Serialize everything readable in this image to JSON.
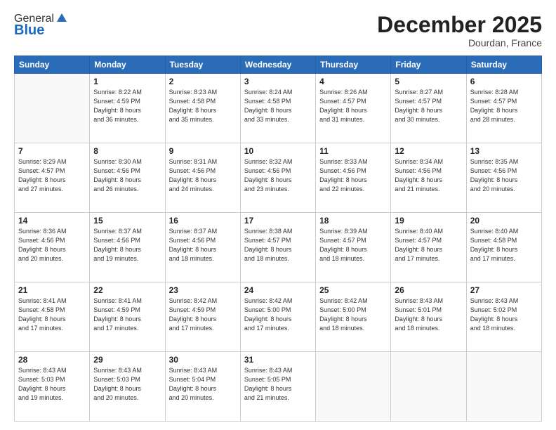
{
  "logo": {
    "general": "General",
    "blue": "Blue"
  },
  "header": {
    "month": "December 2025",
    "location": "Dourdan, France"
  },
  "days_of_week": [
    "Sunday",
    "Monday",
    "Tuesday",
    "Wednesday",
    "Thursday",
    "Friday",
    "Saturday"
  ],
  "weeks": [
    [
      {
        "day": "",
        "info": ""
      },
      {
        "day": "1",
        "info": "Sunrise: 8:22 AM\nSunset: 4:59 PM\nDaylight: 8 hours\nand 36 minutes."
      },
      {
        "day": "2",
        "info": "Sunrise: 8:23 AM\nSunset: 4:58 PM\nDaylight: 8 hours\nand 35 minutes."
      },
      {
        "day": "3",
        "info": "Sunrise: 8:24 AM\nSunset: 4:58 PM\nDaylight: 8 hours\nand 33 minutes."
      },
      {
        "day": "4",
        "info": "Sunrise: 8:26 AM\nSunset: 4:57 PM\nDaylight: 8 hours\nand 31 minutes."
      },
      {
        "day": "5",
        "info": "Sunrise: 8:27 AM\nSunset: 4:57 PM\nDaylight: 8 hours\nand 30 minutes."
      },
      {
        "day": "6",
        "info": "Sunrise: 8:28 AM\nSunset: 4:57 PM\nDaylight: 8 hours\nand 28 minutes."
      }
    ],
    [
      {
        "day": "7",
        "info": "Sunrise: 8:29 AM\nSunset: 4:57 PM\nDaylight: 8 hours\nand 27 minutes."
      },
      {
        "day": "8",
        "info": "Sunrise: 8:30 AM\nSunset: 4:56 PM\nDaylight: 8 hours\nand 26 minutes."
      },
      {
        "day": "9",
        "info": "Sunrise: 8:31 AM\nSunset: 4:56 PM\nDaylight: 8 hours\nand 24 minutes."
      },
      {
        "day": "10",
        "info": "Sunrise: 8:32 AM\nSunset: 4:56 PM\nDaylight: 8 hours\nand 23 minutes."
      },
      {
        "day": "11",
        "info": "Sunrise: 8:33 AM\nSunset: 4:56 PM\nDaylight: 8 hours\nand 22 minutes."
      },
      {
        "day": "12",
        "info": "Sunrise: 8:34 AM\nSunset: 4:56 PM\nDaylight: 8 hours\nand 21 minutes."
      },
      {
        "day": "13",
        "info": "Sunrise: 8:35 AM\nSunset: 4:56 PM\nDaylight: 8 hours\nand 20 minutes."
      }
    ],
    [
      {
        "day": "14",
        "info": "Sunrise: 8:36 AM\nSunset: 4:56 PM\nDaylight: 8 hours\nand 20 minutes."
      },
      {
        "day": "15",
        "info": "Sunrise: 8:37 AM\nSunset: 4:56 PM\nDaylight: 8 hours\nand 19 minutes."
      },
      {
        "day": "16",
        "info": "Sunrise: 8:37 AM\nSunset: 4:56 PM\nDaylight: 8 hours\nand 18 minutes."
      },
      {
        "day": "17",
        "info": "Sunrise: 8:38 AM\nSunset: 4:57 PM\nDaylight: 8 hours\nand 18 minutes."
      },
      {
        "day": "18",
        "info": "Sunrise: 8:39 AM\nSunset: 4:57 PM\nDaylight: 8 hours\nand 18 minutes."
      },
      {
        "day": "19",
        "info": "Sunrise: 8:40 AM\nSunset: 4:57 PM\nDaylight: 8 hours\nand 17 minutes."
      },
      {
        "day": "20",
        "info": "Sunrise: 8:40 AM\nSunset: 4:58 PM\nDaylight: 8 hours\nand 17 minutes."
      }
    ],
    [
      {
        "day": "21",
        "info": "Sunrise: 8:41 AM\nSunset: 4:58 PM\nDaylight: 8 hours\nand 17 minutes."
      },
      {
        "day": "22",
        "info": "Sunrise: 8:41 AM\nSunset: 4:59 PM\nDaylight: 8 hours\nand 17 minutes."
      },
      {
        "day": "23",
        "info": "Sunrise: 8:42 AM\nSunset: 4:59 PM\nDaylight: 8 hours\nand 17 minutes."
      },
      {
        "day": "24",
        "info": "Sunrise: 8:42 AM\nSunset: 5:00 PM\nDaylight: 8 hours\nand 17 minutes."
      },
      {
        "day": "25",
        "info": "Sunrise: 8:42 AM\nSunset: 5:00 PM\nDaylight: 8 hours\nand 18 minutes."
      },
      {
        "day": "26",
        "info": "Sunrise: 8:43 AM\nSunset: 5:01 PM\nDaylight: 8 hours\nand 18 minutes."
      },
      {
        "day": "27",
        "info": "Sunrise: 8:43 AM\nSunset: 5:02 PM\nDaylight: 8 hours\nand 18 minutes."
      }
    ],
    [
      {
        "day": "28",
        "info": "Sunrise: 8:43 AM\nSunset: 5:03 PM\nDaylight: 8 hours\nand 19 minutes."
      },
      {
        "day": "29",
        "info": "Sunrise: 8:43 AM\nSunset: 5:03 PM\nDaylight: 8 hours\nand 20 minutes."
      },
      {
        "day": "30",
        "info": "Sunrise: 8:43 AM\nSunset: 5:04 PM\nDaylight: 8 hours\nand 20 minutes."
      },
      {
        "day": "31",
        "info": "Sunrise: 8:43 AM\nSunset: 5:05 PM\nDaylight: 8 hours\nand 21 minutes."
      },
      {
        "day": "",
        "info": ""
      },
      {
        "day": "",
        "info": ""
      },
      {
        "day": "",
        "info": ""
      }
    ]
  ]
}
